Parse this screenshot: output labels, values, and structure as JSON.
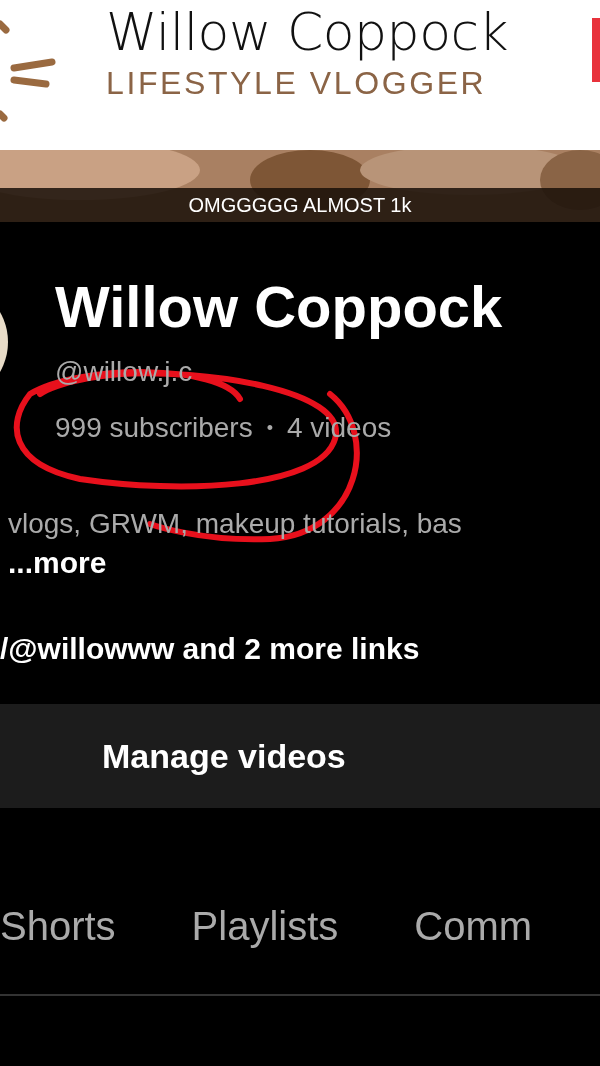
{
  "banner": {
    "title": "Willow Coppock",
    "subtitle": "LIFESTYLE VLOGGER",
    "kind": "picture"
  },
  "caption": "OMGGGGG ALMOST 1k",
  "channel": {
    "name": "Willow Coppock",
    "handle": "@willow.j.c",
    "subscribers": "999 subscribers",
    "separator": "•",
    "videos": "4 videos",
    "description": "vlogs, GRWM, makeup tutorials, bas",
    "more": "...more",
    "links": "/@willowww and 2 more links"
  },
  "manage_button": "Manage videos",
  "tabs": [
    {
      "label": "Shorts"
    },
    {
      "label": "Playlists"
    },
    {
      "label": "Comm"
    }
  ]
}
